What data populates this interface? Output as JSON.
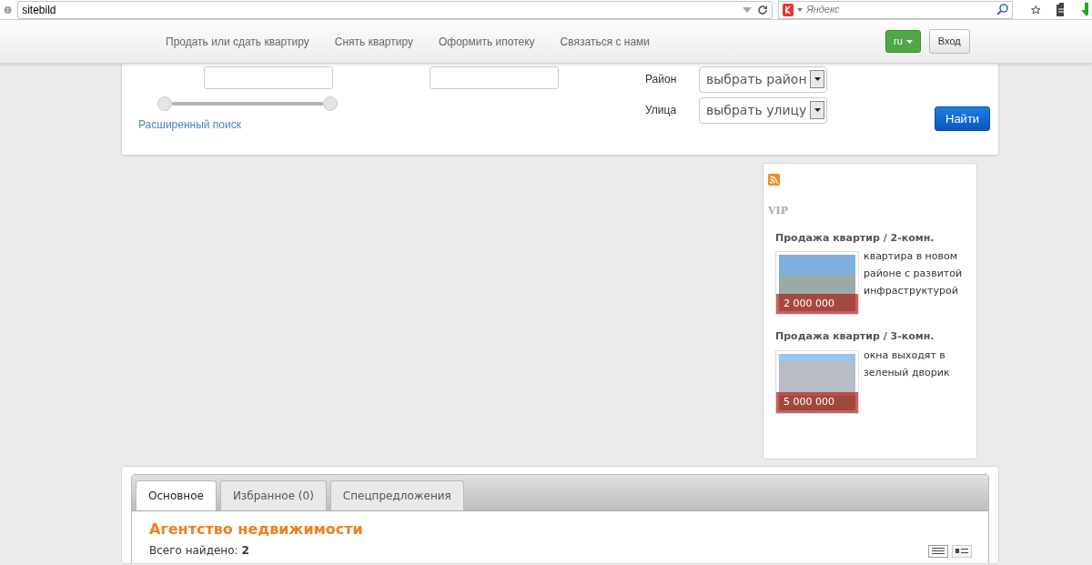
{
  "browser": {
    "address": "sitebild",
    "search_placeholder": "Яндекс"
  },
  "navbar": {
    "links": [
      "Продать или сдать квартиру",
      "Снять квартиру",
      "Оформить ипотеку",
      "Связаться с нами"
    ],
    "language": "ru",
    "login": "Вход"
  },
  "search": {
    "price_slider": {
      "level": 1
    },
    "advanced_link": "Расширенный поиск",
    "district": {
      "label": "Район",
      "value": "выбрать район"
    },
    "street": {
      "label": "Улица",
      "value": "выбрать улицу"
    },
    "submit": "Найти"
  },
  "sidebar": {
    "heading": "VIP",
    "listings": [
      {
        "title": "Продажа квартир / 2-комн.",
        "description": "квартира в новом районе с развитой инфраструктурой",
        "price": "2 000 000"
      },
      {
        "title": "Продажа квартир / 3-комн.",
        "description": "окна выходят в зеленый дворик",
        "price": "5 000 000"
      }
    ]
  },
  "tabs": [
    {
      "label": "Основное",
      "selected": true
    },
    {
      "label": "Избранное (0)",
      "selected": false
    },
    {
      "label": "Спецпредложения",
      "selected": false
    }
  ],
  "content": {
    "title": "Агентство недвижимости",
    "found": "Всего найдено: **2**",
    "views": [
      {
        "kind": "list",
        "selected": true
      },
      {
        "kind": "grid",
        "selected": false
      }
    ]
  }
}
